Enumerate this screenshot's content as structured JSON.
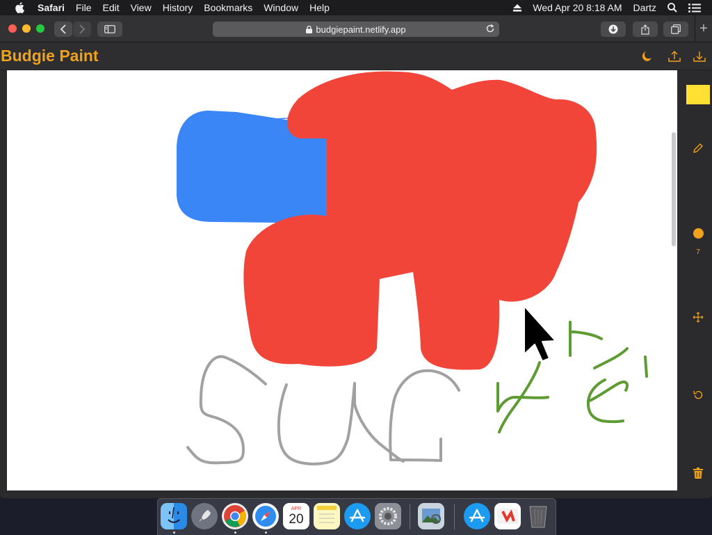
{
  "menubar": {
    "app_name": "Safari",
    "menus": [
      "File",
      "Edit",
      "View",
      "History",
      "Bookmarks",
      "Window",
      "Help"
    ],
    "datetime": "Wed Apr 20  8:18 AM",
    "user": "Dartz"
  },
  "browser": {
    "url": "budgiepaint.netlify.app",
    "new_tab_label": "+"
  },
  "app": {
    "title": "Budgie Paint",
    "selected_color": "#ffe033",
    "brush_color": "#f0a21b",
    "brush_size": "7"
  },
  "drawing": {
    "stroke_colors": {
      "blue": "#3b86f7",
      "red": "#f2453a",
      "gray": "#a1a1a1",
      "green": "#5e9b32"
    }
  },
  "dock": {
    "calendar_month": "APR",
    "calendar_day": "20"
  }
}
